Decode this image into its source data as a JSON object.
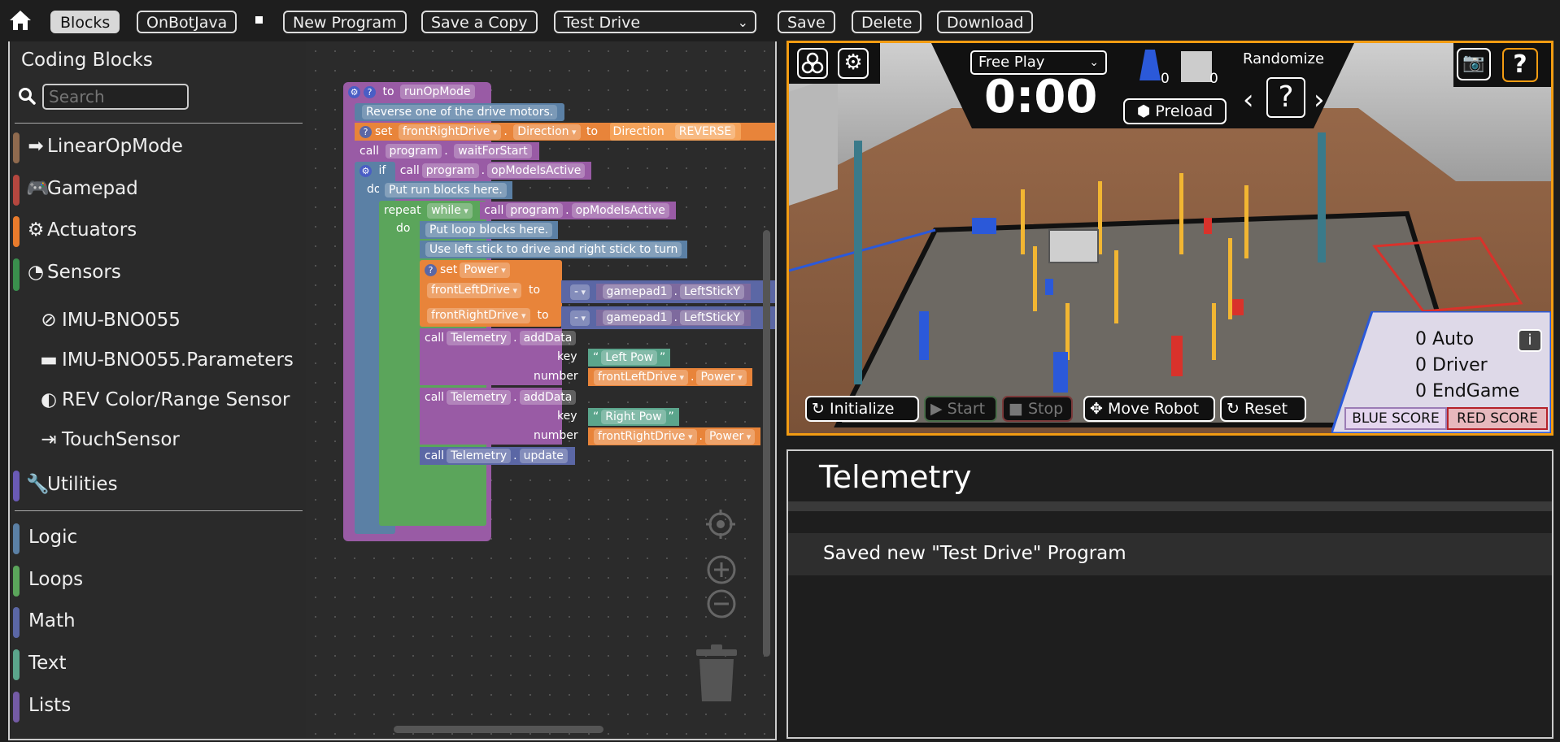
{
  "toolbar": {
    "blocks": "Blocks",
    "onbotjava": "OnBotJava",
    "new_program": "New Program",
    "save_copy": "Save a Copy",
    "program_select": "Test Drive",
    "save": "Save",
    "delete": "Delete",
    "download": "Download"
  },
  "toolbox": {
    "title": "Coding Blocks",
    "search_placeholder": "Search",
    "categories": [
      {
        "label": "LinearOpMode",
        "icon": "arrow-right-icon",
        "color": "#8f6a4e"
      },
      {
        "label": "Gamepad",
        "icon": "gamepad-icon",
        "color": "#b5473f"
      },
      {
        "label": "Actuators",
        "icon": "gear-icon",
        "color": "#e87b2c"
      },
      {
        "label": "Sensors",
        "icon": "gauge-icon",
        "color": "#3a8f4d"
      }
    ],
    "sensor_items": [
      {
        "label": "IMU-BNO055",
        "icon": "compass-icon"
      },
      {
        "label": "IMU-BNO055.Parameters",
        "icon": "folder-icon"
      },
      {
        "label": "REV Color/Range Sensor",
        "icon": "half-circle-icon"
      },
      {
        "label": "TouchSensor",
        "icon": "sign-in-icon"
      }
    ],
    "utilities": {
      "label": "Utilities",
      "icon": "wrench-icon",
      "color": "#6a5ab5"
    },
    "builtins": [
      {
        "label": "Logic",
        "color": "#5b80a5"
      },
      {
        "label": "Loops",
        "color": "#5ba55b"
      },
      {
        "label": "Math",
        "color": "#5b67a5"
      },
      {
        "label": "Text",
        "color": "#5ba58c"
      },
      {
        "label": "Lists",
        "color": "#745ba5"
      }
    ]
  },
  "blocks": {
    "fn_to": "to",
    "fn_name": "runOpMode",
    "comment1": "Reverse one of the drive motors.",
    "set": "set",
    "motor_right": "frontRightDrive",
    "motor_left": "frontLeftDrive",
    "direction": "Direction",
    "to": "to",
    "direction_val": "Direction",
    "reverse": "REVERSE",
    "call": "call",
    "program": "program",
    "waitForStart": "waitForStart",
    "if": "if",
    "opModeIsActive": "opModeIsActive",
    "do": "do",
    "comment2": "Put run blocks here.",
    "repeat": "repeat",
    "while": "while",
    "comment3": "Put loop blocks here.",
    "comment4": "Use left stick to drive and right stick to turn",
    "power": "Power",
    "minus": "-",
    "gamepad1": "gamepad1",
    "leftStickY": "LeftStickY",
    "telemetry": "Telemetry",
    "addData": "addData",
    "key": "key",
    "number": "number",
    "left_pow": "Left Pow",
    "right_pow": "Right Pow",
    "update": "update",
    "dot": "."
  },
  "sim": {
    "mode": "Free Play",
    "timer": "0:00",
    "preload": "Preload",
    "randomize": "Randomize",
    "randomize_value": "?",
    "cone_count_blue": "0",
    "cone_count_sign": "0",
    "scores": [
      {
        "value": "0",
        "label": "Auto"
      },
      {
        "value": "0",
        "label": "Driver"
      },
      {
        "value": "0",
        "label": "EndGame"
      }
    ],
    "blue_score": "BLUE SCORE",
    "red_score": "RED SCORE",
    "initialize": "Initialize",
    "start": "Start",
    "stop": "Stop",
    "move_robot": "Move Robot",
    "reset": "Reset",
    "help": "?"
  },
  "telemetry": {
    "title": "Telemetry",
    "message": "Saved new \"Test Drive\" Program"
  },
  "colors": {
    "accent_orange": "#f39c12",
    "block_purple": "#995ba5",
    "block_orange": "#e8843a",
    "block_green": "#5ba55b",
    "block_blue": "#5b80a5"
  }
}
